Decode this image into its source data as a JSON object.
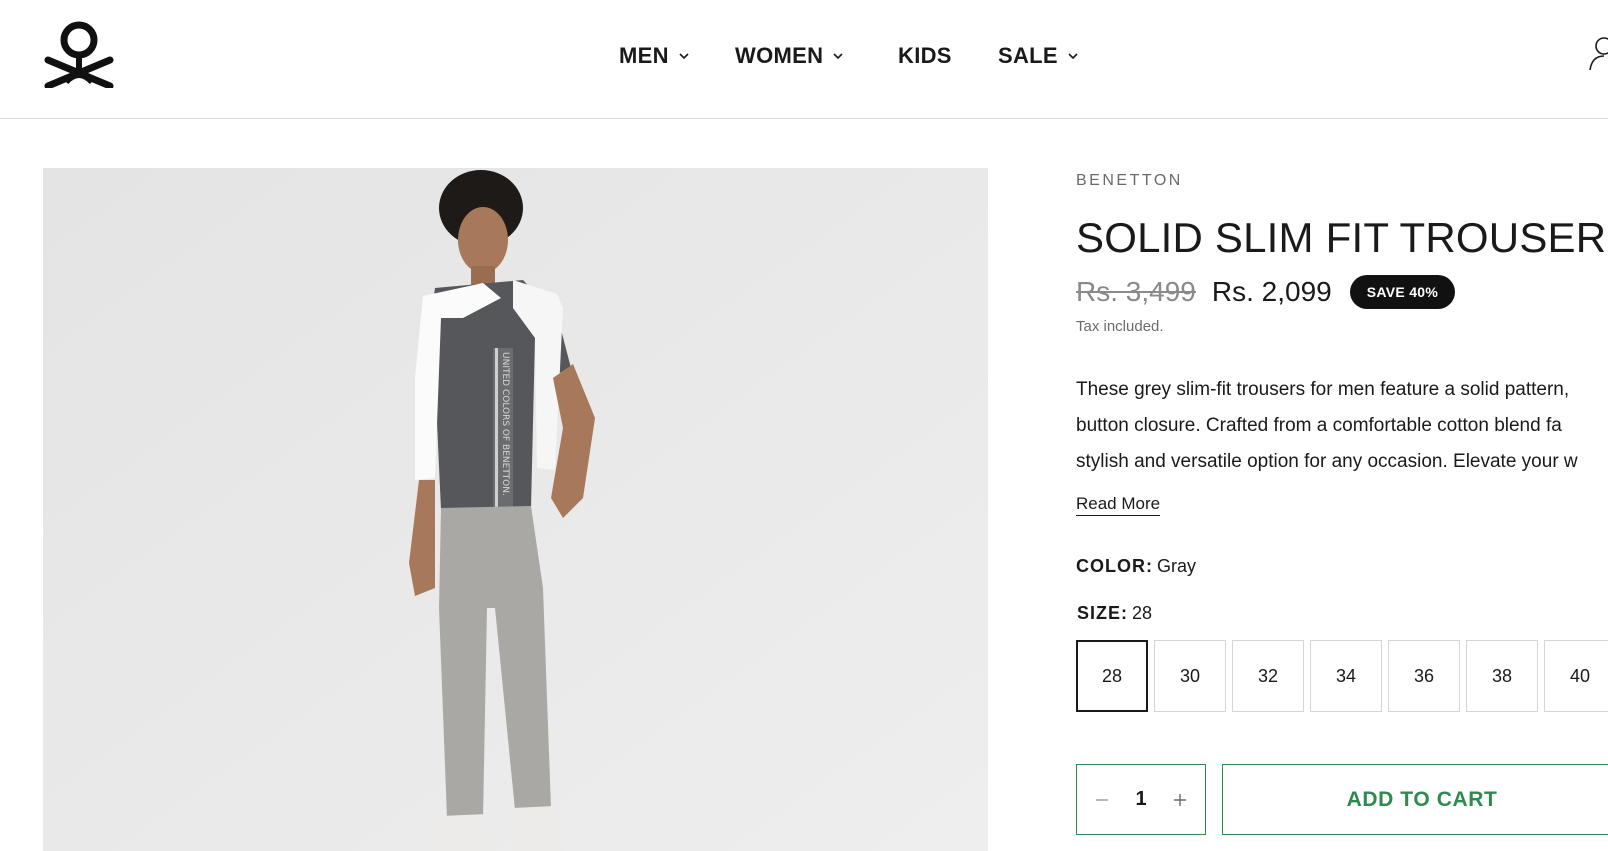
{
  "header": {
    "logo_icon": "benetton-logo-icon",
    "nav": [
      {
        "label": "MEN",
        "has_dropdown": true
      },
      {
        "label": "WOMEN",
        "has_dropdown": true
      },
      {
        "label": "KIDS",
        "has_dropdown": false
      },
      {
        "label": "SALE",
        "has_dropdown": true
      }
    ],
    "account_icon": "user-icon"
  },
  "product": {
    "vendor": "BENETTON",
    "title": "SOLID SLIM FIT TROUSERS",
    "price_compare": "Rs. 3,499",
    "price": "Rs. 2,099",
    "save_badge": "SAVE 40%",
    "tax_note": "Tax included.",
    "description_lines": [
      "These grey slim-fit trousers for men feature a solid pattern,",
      "button closure. Crafted from a comfortable cotton blend fa",
      "stylish and versatile option for any occasion. Elevate your w"
    ],
    "read_more": "Read More",
    "color_label": "COLOR:",
    "color_value": "Gray",
    "size_label": "SIZE:",
    "size_value": "28",
    "sizes": [
      "28",
      "30",
      "32",
      "34",
      "36",
      "38",
      "40"
    ],
    "selected_size": "28",
    "quantity": "1",
    "add_to_cart": "ADD TO CART",
    "image_print_text": "UNITED COLORS OF BENETTON."
  },
  "colors": {
    "accent_green": "#2f8a4f",
    "badge_bg": "#111111"
  }
}
